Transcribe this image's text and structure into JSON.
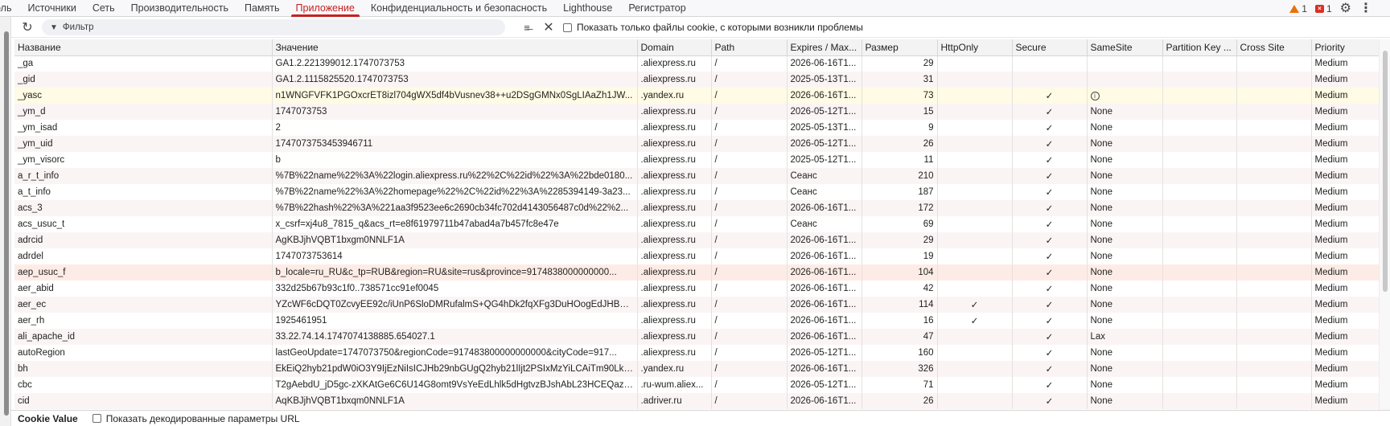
{
  "tabs": [
    {
      "label": "оль",
      "active": false
    },
    {
      "label": "Источники",
      "active": false
    },
    {
      "label": "Сеть",
      "active": false
    },
    {
      "label": "Производительность",
      "active": false
    },
    {
      "label": "Память",
      "active": false
    },
    {
      "label": "Приложение",
      "active": true
    },
    {
      "label": "Конфиденциальность и безопасность",
      "active": false
    },
    {
      "label": "Lighthouse",
      "active": false
    },
    {
      "label": "Регистратор",
      "active": false
    }
  ],
  "status": {
    "warnings": "1",
    "errors": "1",
    "settings_icon": "gear-icon",
    "menu_icon": "kebab-icon"
  },
  "toolbar": {
    "filter_placeholder": "Фильтр",
    "only_issues_label": "Показать только файлы cookie, с которыми возникли проблемы"
  },
  "colors": {
    "accent": "#c5221f",
    "warning": "#e8710a",
    "error": "#d93025",
    "highlight_yellow": "#fffbe4",
    "highlight_pink": "#fdece6",
    "stripe": "#fbf4f5"
  },
  "columns": [
    "Название",
    "Значение",
    "Domain",
    "Path",
    "Expires / Max...",
    "Размер",
    "HttpOnly",
    "Secure",
    "SameSite",
    "Partition Key ...",
    "Cross Site",
    "Priority"
  ],
  "rows": [
    {
      "name": "_ga",
      "value": "GA1.2.221399012.1747073753",
      "domain": ".aliexpress.ru",
      "path": "/",
      "expires": "2026-06-16T1...",
      "size": "29",
      "httponly": "",
      "secure": "",
      "samesite": "",
      "partition": "",
      "crosssite": "",
      "priority": "Medium",
      "hl": ""
    },
    {
      "name": "_gid",
      "value": "GA1.2.1115825520.1747073753",
      "domain": ".aliexpress.ru",
      "path": "/",
      "expires": "2025-05-13T1...",
      "size": "31",
      "httponly": "",
      "secure": "",
      "samesite": "",
      "partition": "",
      "crosssite": "",
      "priority": "Medium",
      "hl": ""
    },
    {
      "name": "_yasc",
      "value": "n1WNGFVFK1PGOxcrET8izl704gWX5df4bVusnev38++u2DSgGMNx0SgLIAaZh1JW...",
      "domain": ".yandex.ru",
      "path": "/",
      "expires": "2026-06-16T1...",
      "size": "73",
      "httponly": "",
      "secure": "✓",
      "samesite": "",
      "samesite_info": true,
      "partition": "",
      "crosssite": "",
      "priority": "Medium",
      "hl": "yellow"
    },
    {
      "name": "_ym_d",
      "value": "1747073753",
      "domain": ".aliexpress.ru",
      "path": "/",
      "expires": "2026-05-12T1...",
      "size": "15",
      "httponly": "",
      "secure": "✓",
      "samesite": "None",
      "partition": "",
      "crosssite": "",
      "priority": "Medium",
      "hl": ""
    },
    {
      "name": "_ym_isad",
      "value": "2",
      "domain": ".aliexpress.ru",
      "path": "/",
      "expires": "2025-05-13T1...",
      "size": "9",
      "httponly": "",
      "secure": "✓",
      "samesite": "None",
      "partition": "",
      "crosssite": "",
      "priority": "Medium",
      "hl": ""
    },
    {
      "name": "_ym_uid",
      "value": "1747073753453946711",
      "domain": ".aliexpress.ru",
      "path": "/",
      "expires": "2026-05-12T1...",
      "size": "26",
      "httponly": "",
      "secure": "✓",
      "samesite": "None",
      "partition": "",
      "crosssite": "",
      "priority": "Medium",
      "hl": ""
    },
    {
      "name": "_ym_visorc",
      "value": "b",
      "domain": ".aliexpress.ru",
      "path": "/",
      "expires": "2025-05-12T1...",
      "size": "11",
      "httponly": "",
      "secure": "✓",
      "samesite": "None",
      "partition": "",
      "crosssite": "",
      "priority": "Medium",
      "hl": ""
    },
    {
      "name": "a_r_t_info",
      "value": "%7B%22name%22%3A%22login.aliexpress.ru%22%2C%22id%22%3A%22bde0180...",
      "domain": ".aliexpress.ru",
      "path": "/",
      "expires": "Сеанс",
      "size": "210",
      "httponly": "",
      "secure": "✓",
      "samesite": "None",
      "partition": "",
      "crosssite": "",
      "priority": "Medium",
      "hl": ""
    },
    {
      "name": "a_t_info",
      "value": "%7B%22name%22%3A%22homepage%22%2C%22id%22%3A%2285394149-3a23...",
      "domain": ".aliexpress.ru",
      "path": "/",
      "expires": "Сеанс",
      "size": "187",
      "httponly": "",
      "secure": "✓",
      "samesite": "None",
      "partition": "",
      "crosssite": "",
      "priority": "Medium",
      "hl": ""
    },
    {
      "name": "acs_3",
      "value": "%7B%22hash%22%3A%221aa3f9523ee6c2690cb34fc702d4143056487c0d%22%2...",
      "domain": ".aliexpress.ru",
      "path": "/",
      "expires": "2026-06-16T1...",
      "size": "172",
      "httponly": "",
      "secure": "✓",
      "samesite": "None",
      "partition": "",
      "crosssite": "",
      "priority": "Medium",
      "hl": ""
    },
    {
      "name": "acs_usuc_t",
      "value": "x_csrf=xj4u8_7815_q&acs_rt=e8f61979711b47abad4a7b457fc8e47e",
      "domain": ".aliexpress.ru",
      "path": "/",
      "expires": "Сеанс",
      "size": "69",
      "httponly": "",
      "secure": "✓",
      "samesite": "None",
      "partition": "",
      "crosssite": "",
      "priority": "Medium",
      "hl": ""
    },
    {
      "name": "adrcid",
      "value": "AgKBJjhVQBT1bxgm0NNLF1A",
      "domain": ".aliexpress.ru",
      "path": "/",
      "expires": "2026-06-16T1...",
      "size": "29",
      "httponly": "",
      "secure": "✓",
      "samesite": "None",
      "partition": "",
      "crosssite": "",
      "priority": "Medium",
      "hl": ""
    },
    {
      "name": "adrdel",
      "value": "1747073753614",
      "domain": ".aliexpress.ru",
      "path": "/",
      "expires": "2026-06-16T1...",
      "size": "19",
      "httponly": "",
      "secure": "✓",
      "samesite": "None",
      "partition": "",
      "crosssite": "",
      "priority": "Medium",
      "hl": ""
    },
    {
      "name": "aep_usuc_f",
      "value": "b_locale=ru_RU&c_tp=RUB&region=RU&site=rus&province=9174838000000000...",
      "domain": ".aliexpress.ru",
      "path": "/",
      "expires": "2026-06-16T1...",
      "size": "104",
      "httponly": "",
      "secure": "✓",
      "samesite": "None",
      "partition": "",
      "crosssite": "",
      "priority": "Medium",
      "hl": "pink"
    },
    {
      "name": "aer_abid",
      "value": "332d25b67b93c1f0..738571cc91ef0045",
      "domain": ".aliexpress.ru",
      "path": "/",
      "expires": "2026-06-16T1...",
      "size": "42",
      "httponly": "",
      "secure": "✓",
      "samesite": "None",
      "partition": "",
      "crosssite": "",
      "priority": "Medium",
      "hl": ""
    },
    {
      "name": "aer_ec",
      "value": "YZcWF6cDQT0ZcvyEE92c/iUnP6SloDMRufalmS+QG4hDk2fqXFg3DuHOogEdJHBN...",
      "domain": ".aliexpress.ru",
      "path": "/",
      "expires": "2026-06-16T1...",
      "size": "114",
      "httponly": "✓",
      "secure": "✓",
      "samesite": "None",
      "partition": "",
      "crosssite": "",
      "priority": "Medium",
      "hl": ""
    },
    {
      "name": "aer_rh",
      "value": "1925461951",
      "domain": ".aliexpress.ru",
      "path": "/",
      "expires": "2026-06-16T1...",
      "size": "16",
      "httponly": "✓",
      "secure": "✓",
      "samesite": "None",
      "partition": "",
      "crosssite": "",
      "priority": "Medium",
      "hl": ""
    },
    {
      "name": "ali_apache_id",
      "value": "33.22.74.14.1747074138885.654027.1",
      "domain": ".aliexpress.ru",
      "path": "/",
      "expires": "2026-06-16T1...",
      "size": "47",
      "httponly": "",
      "secure": "✓",
      "samesite": "Lax",
      "partition": "",
      "crosssite": "",
      "priority": "Medium",
      "hl": ""
    },
    {
      "name": "autoRegion",
      "value": "lastGeoUpdate=1747073750&regionCode=917483800000000000&cityCode=917...",
      "domain": ".aliexpress.ru",
      "path": "/",
      "expires": "2026-05-12T1...",
      "size": "160",
      "httponly": "",
      "secure": "✓",
      "samesite": "None",
      "partition": "",
      "crosssite": "",
      "priority": "Medium",
      "hl": ""
    },
    {
      "name": "bh",
      "value": "EkEiQ2hyb21pdW0iO3Y9IjEzNiIsICJHb29nbGUgQ2hyb21lIjt2PSIxMzYiLCAiTm90LkE...",
      "domain": ".yandex.ru",
      "path": "/",
      "expires": "2026-06-16T1...",
      "size": "326",
      "httponly": "",
      "secure": "✓",
      "samesite": "None",
      "partition": "",
      "crosssite": "",
      "priority": "Medium",
      "hl": ""
    },
    {
      "name": "cbc",
      "value": "T2gAebdU_jD5gc-zXKAtGe6C6U14G8omt9VsYeEdLhlk5dHgtvzBJshAbL23HCEQazg=",
      "domain": ".ru-wum.aliex...",
      "path": "/",
      "expires": "2026-05-12T1...",
      "size": "71",
      "httponly": "",
      "secure": "✓",
      "samesite": "None",
      "partition": "",
      "crosssite": "",
      "priority": "Medium",
      "hl": ""
    },
    {
      "name": "cid",
      "value": "AqKBJjhVQBT1bxqm0NNLF1A",
      "domain": ".adriver.ru",
      "path": "/",
      "expires": "2026-06-16T1...",
      "size": "26",
      "httponly": "",
      "secure": "✓",
      "samesite": "None",
      "partition": "",
      "crosssite": "",
      "priority": "Medium",
      "hl": ""
    }
  ],
  "bottom": {
    "title": "Cookie Value",
    "decode_label": "Показать декодированные параметры URL"
  }
}
